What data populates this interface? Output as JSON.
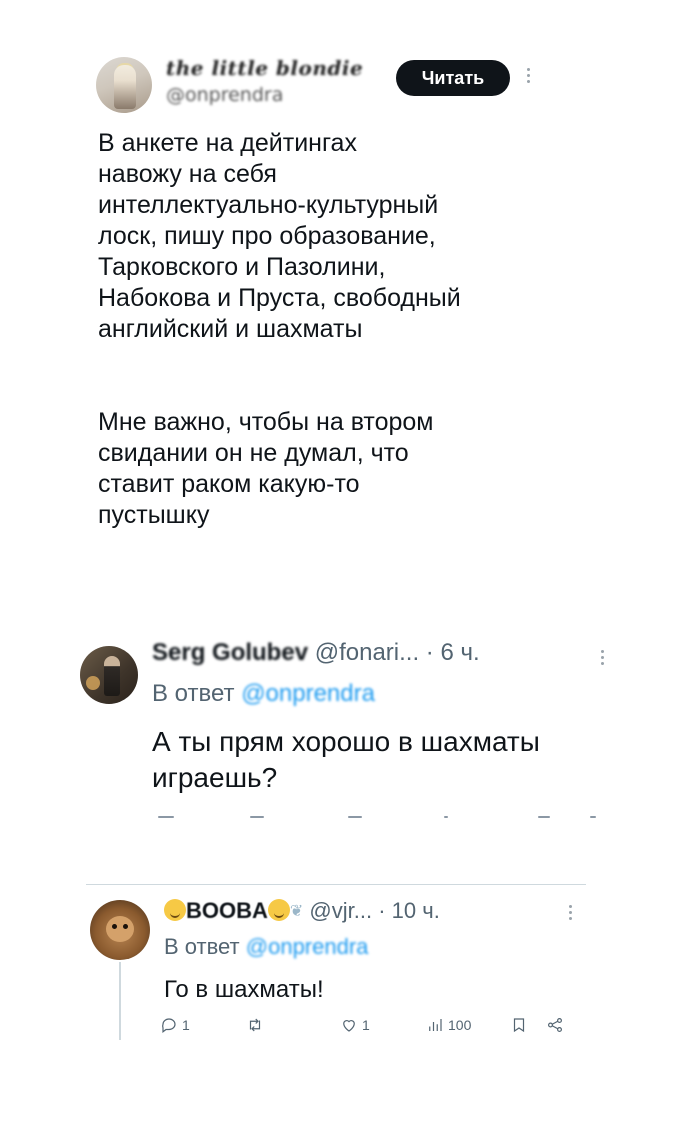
{
  "tweet": {
    "author_name": "the little blondie",
    "author_handle": "@onprendra",
    "follow_label": "Читать",
    "text_paragraph_1": [
      "В анкете на дейтингах",
      "навожу на себя",
      "интеллектуально-культурный",
      "лоск, пишу про образование,",
      "Тарковского и Пазолини,",
      "Набокова и Пруста, свободный",
      "английский и шахматы"
    ],
    "text_paragraph_2": [
      "Мне важно, чтобы на втором",
      "свидании он не думал, что",
      "ставит раком какую-то",
      "пустышку"
    ]
  },
  "reply_1": {
    "name": "Serg Golubev",
    "handle": "@fonari...",
    "separator": "·",
    "time": "6 ч.",
    "reply_prefix": "В ответ",
    "reply_mention": "@onprendra",
    "text_lines": [
      "А ты прям хорошо в шахматы",
      "играешь?"
    ]
  },
  "reply_2": {
    "name": "BOOBA",
    "handle": "@vjr...",
    "separator": "·",
    "time": "10 ч.",
    "reply_prefix": "В ответ",
    "reply_mention": "@onprendra",
    "text": "Го в шахматы!",
    "actions": {
      "replies": "1",
      "retweets": "",
      "likes": "1",
      "views": "100"
    }
  },
  "icons": {
    "reply": "reply-icon",
    "retweet": "retweet-icon",
    "like": "heart-icon",
    "views": "views-chart-icon",
    "bookmark": "bookmark-icon",
    "share": "share-icon",
    "more": "more-vertical-icon"
  }
}
